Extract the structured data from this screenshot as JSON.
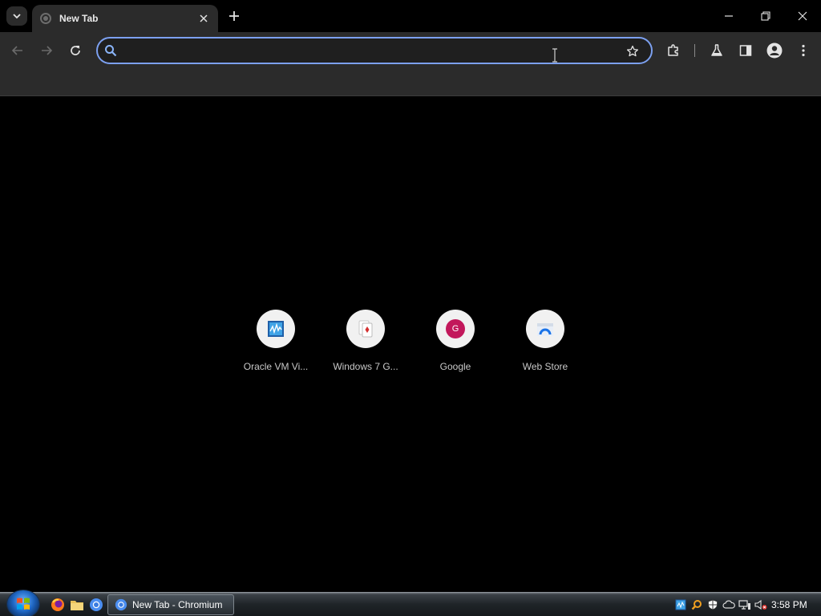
{
  "tab": {
    "title": "New Tab"
  },
  "omnibox": {
    "value": "",
    "placeholder": ""
  },
  "shortcuts": [
    {
      "title": "Oracle VM Vi...",
      "icon": "virtualbox-icon"
    },
    {
      "title": "Windows 7 G...",
      "icon": "playing-card-icon"
    },
    {
      "title": "Google",
      "icon": "letter-g-icon",
      "letter": "G",
      "color": "#c2185b"
    },
    {
      "title": "Web Store",
      "icon": "webstore-icon"
    }
  ],
  "taskbar": {
    "task_label": "New Tab - Chromium",
    "clock": "3:58 PM"
  },
  "colors": {
    "accent": "#7ca0f0",
    "toolbar_bg": "#2b2b2b",
    "page_bg": "#000000"
  }
}
